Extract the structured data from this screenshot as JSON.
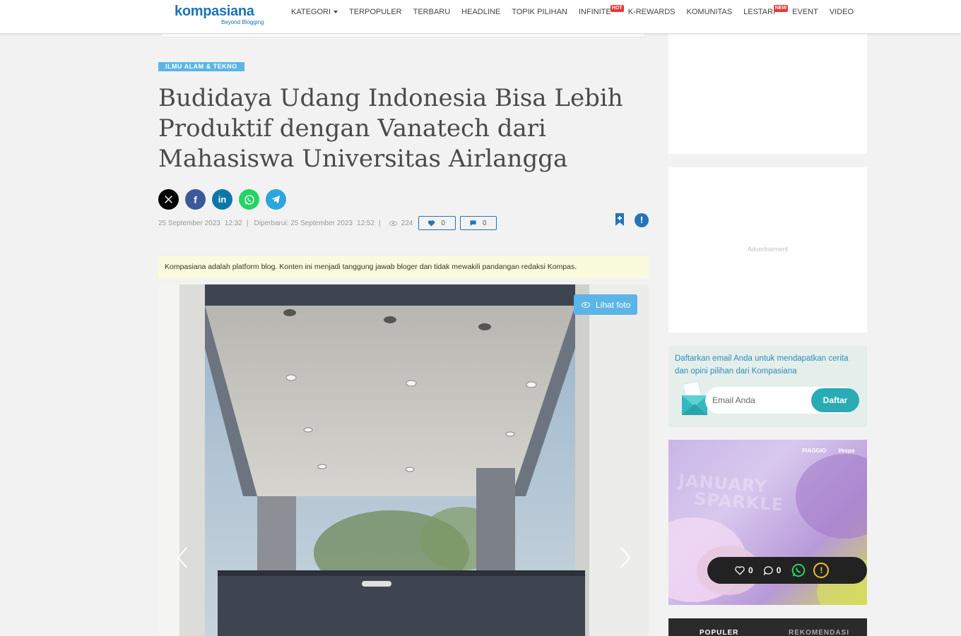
{
  "header": {
    "logo_text": "kompasiana",
    "logo_tagline": "Beyond Blogging",
    "nav": [
      {
        "label": "KATEGORI",
        "badge": ""
      },
      {
        "label": "TERPOPULER",
        "badge": ""
      },
      {
        "label": "TERBARU",
        "badge": ""
      },
      {
        "label": "HEADLINE",
        "badge": ""
      },
      {
        "label": "TOPIK PILIHAN",
        "badge": ""
      },
      {
        "label": "INFINITE",
        "badge": "HOT"
      },
      {
        "label": "K-REWARDS",
        "badge": ""
      },
      {
        "label": "KOMUNITAS",
        "badge": ""
      },
      {
        "label": "LESTARI",
        "badge": "NEW"
      },
      {
        "label": "EVENT",
        "badge": ""
      },
      {
        "label": "VIDEO",
        "badge": ""
      }
    ]
  },
  "article": {
    "category": "ILMU ALAM & TEKNO",
    "title": "Budidaya Udang Indonesia Bisa Lebih Produktif dengan Vanatech dari Mahasiswa Universitas Airlangga",
    "share": [
      {
        "name": "x-icon",
        "glyph": "𝕏"
      },
      {
        "name": "facebook-icon",
        "glyph": "f"
      },
      {
        "name": "linkedin-icon",
        "glyph": "in"
      },
      {
        "name": "whatsapp-icon",
        "glyph": "✆"
      },
      {
        "name": "telegram-icon",
        "glyph": "➤"
      }
    ],
    "published_date": "25 September 2023",
    "published_time": "12:32",
    "updated_label": "Diperbarui: 25 September 2023",
    "updated_time": "12:52",
    "views": "224",
    "likes": "0",
    "comments": "0",
    "disclaimer": "Kompasiana adalah platform blog. Konten ini menjadi tanggung jawab bloger dan tidak mewakili pandangan redaksi Kompas.",
    "photo_button": "Lihat foto"
  },
  "sidebar": {
    "ad_label": "Advertisement",
    "newsletter_text": "Daftarkan email Anda untuk mendapatkan cerita dan opini pilihan dari Kompasiana",
    "email_placeholder": "Email Anda",
    "subscribe_button": "Daftar",
    "promo_brand_left": "PIAGGIO",
    "promo_brand_right": "Vespa",
    "promo_word_1": "JANUARY",
    "promo_word_2": "SPARKLE",
    "tabs": [
      "POPULER",
      "REKOMENDASI"
    ]
  },
  "floating_bar": {
    "likes": "0",
    "comments": "0"
  },
  "colors": {
    "brand_blue": "#1a73b8",
    "accent_blue": "#2574b8",
    "tag_blue": "#5cb5e6",
    "teal_button": "#2aaab4"
  }
}
